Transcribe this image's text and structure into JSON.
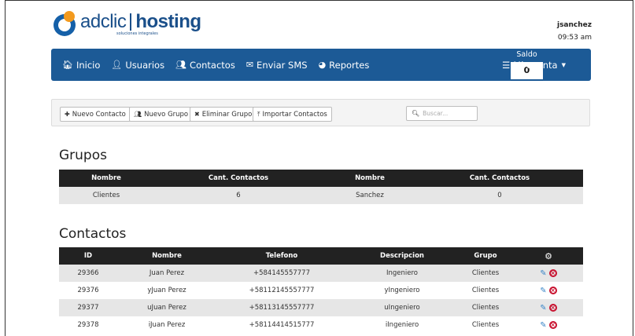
{
  "brand": {
    "name_left": "adclic",
    "name_right": "hosting",
    "tagline": "soluciones integrales"
  },
  "user": {
    "username": "jsanchez",
    "time": "09:53 am"
  },
  "nav": {
    "items": [
      {
        "label": "Inicio",
        "icon": "home-icon"
      },
      {
        "label": "Usuarios",
        "icon": "user-icon"
      },
      {
        "label": "Contactos",
        "icon": "users-icon"
      },
      {
        "label": "Enviar SMS",
        "icon": "envelope-icon"
      },
      {
        "label": "Reportes",
        "icon": "pie-chart-icon"
      }
    ],
    "saldo_label": "Saldo",
    "saldo_value": "0",
    "account_label": "Mi cuenta"
  },
  "toolbar": {
    "nuevo_contacto": "Nuevo Contacto",
    "nuevo_grupo": "Nuevo Grupo",
    "eliminar_grupo": "Eliminar Grupo",
    "importar_contactos": "Importar Contactos",
    "search_placeholder": "Buscar..."
  },
  "grupos": {
    "title": "Grupos",
    "headers": [
      "Nombre",
      "Cant. Contactos",
      "Nombre",
      "Cant. Contactos"
    ],
    "rows": [
      [
        "Clientes",
        "6",
        "Sanchez",
        "0"
      ]
    ]
  },
  "contactos": {
    "title": "Contactos",
    "headers": [
      "ID",
      "Nombre",
      "Telefono",
      "Descripcion",
      "Grupo"
    ],
    "rows": [
      [
        "29366",
        "Juan Perez",
        "+584145557777",
        "Ingeniero",
        "Clientes"
      ],
      [
        "29376",
        "yJuan Perez",
        "+58112145557777",
        "yIngeniero",
        "Clientes"
      ],
      [
        "29377",
        "uJuan Perez",
        "+58113145557777",
        "uIngeniero",
        "Clientes"
      ],
      [
        "29378",
        "iJuan Perez",
        "+58114414515777",
        "iIngeniero",
        "Clientes"
      ]
    ]
  },
  "colors": {
    "navbar": "#1c5a96",
    "logo_blue": "#1a4f8a",
    "logo_orange": "#f39a1e",
    "header_dark": "#222222",
    "delete_red": "#c8102e",
    "edit_blue": "#3a86c8"
  }
}
